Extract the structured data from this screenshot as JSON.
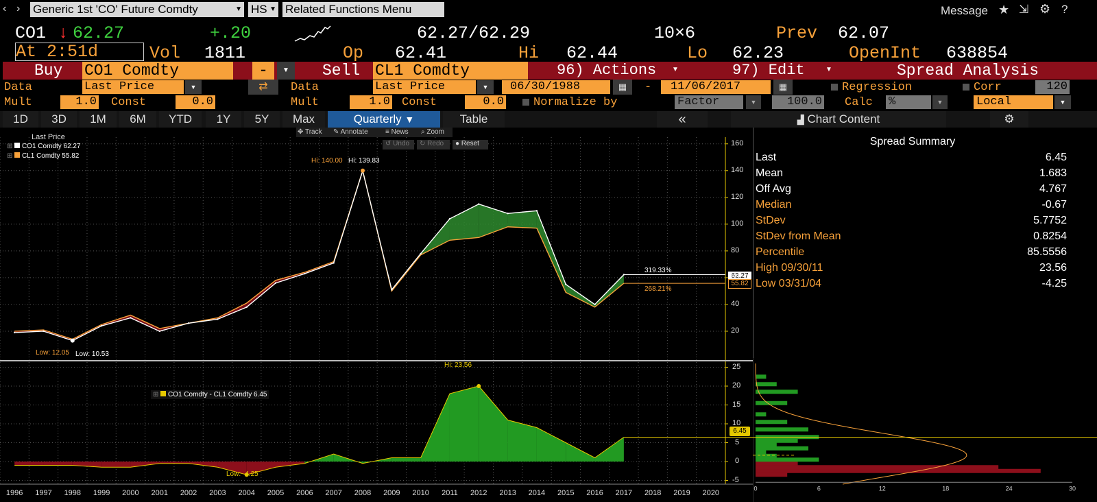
{
  "topbar": {
    "security_title": "Generic 1st 'CO' Future Comdty",
    "hs_label": "HS",
    "related_label": "Related Functions  Menu",
    "message_label": "Message",
    "icons": [
      "star-icon",
      "export-icon",
      "gear-icon",
      "help-icon"
    ]
  },
  "quote": {
    "ticker": "CO1",
    "arrow": "↓",
    "last": "62.27",
    "change": "+.20",
    "bid_ask": "62.27/62.29",
    "size": "10×6",
    "prev_label": "Prev",
    "prev": "62.07",
    "time_label": "At 2:51d",
    "vol_label": "Vol",
    "vol": "1811",
    "open_label": "Op",
    "open": "62.41",
    "hi_label": "Hi",
    "hi": "62.44",
    "lo_label": "Lo",
    "lo": "62.23",
    "oi_label": "OpenInt",
    "oi": "638854"
  },
  "spread_bar": {
    "buy_label": "Buy",
    "buy_ticker": "CO1 Comdty",
    "minus": "-",
    "sell_label": "Sell",
    "sell_ticker": "CL1 Comdty",
    "actions_label": "96) Actions",
    "edit_label": "97) Edit",
    "analysis_label": "Spread Analysis"
  },
  "params": {
    "data_label": "Data",
    "buy_field": "Last Price",
    "sell_field": "Last Price",
    "start_date": "06/30/1988",
    "dash": "-",
    "end_date": "11/06/2017",
    "regression_label": "Regression",
    "corr_label": "Corr",
    "corr_value": "120",
    "mult_label": "Mult",
    "const_label": "Const",
    "buy_mult": "1.0",
    "buy_const": "0.0",
    "sell_mult": "1.0",
    "sell_const": "0.0",
    "normalize_label": "Normalize by",
    "factor_label": "Factor",
    "factor_value": "100.0",
    "calc_label": "Calc",
    "calc_value": "%",
    "local_value": "Local"
  },
  "tabs": [
    "1D",
    "3D",
    "1M",
    "6M",
    "YTD",
    "1Y",
    "5Y",
    "Max"
  ],
  "period_selected": "Quarterly",
  "table_label": "Table",
  "collapse_label": "«",
  "chart_content_label": "Chart Content",
  "toolbar": {
    "track": "Track",
    "annotate": "Annotate",
    "news": "News",
    "zoom": "Zoom",
    "undo": "Undo",
    "redo": "Redo",
    "reset": "Reset"
  },
  "legend": {
    "title": "Last Price",
    "s1": "CO1 Comdty 62.27",
    "s2": "CL1 Comdty 55.82",
    "spread": "CO1 Comdty - CL1 Comdty 6.45"
  },
  "annotations": {
    "hi_orange": "Hi: 140.00",
    "hi_white": "Hi: 139.83",
    "low_orange": "Low: 12.05",
    "low_white": "Low: 10.53",
    "pct_white": "319.33%",
    "pct_orange": "268.21%",
    "last_white": "62.27",
    "last_orange": "55.82",
    "spread_hi": "Hi: 23.56",
    "spread_low": "Low: -4.25",
    "spread_last": "6.45"
  },
  "summary": {
    "title": "Spread Summary",
    "rows": [
      {
        "label": "Last",
        "value": "6.45"
      },
      {
        "label": "Mean",
        "value": "1.683"
      },
      {
        "label": "Off Avg",
        "value": "4.767"
      },
      {
        "label": "Median",
        "value": "-0.67"
      },
      {
        "label": "StDev",
        "value": "5.7752"
      },
      {
        "label": "StDev from Mean",
        "value": "0.8254"
      },
      {
        "label": "Percentile",
        "value": "85.5556"
      },
      {
        "label": "High 09/30/11",
        "value": "23.56"
      },
      {
        "label": "Low 03/31/04",
        "value": "-4.25"
      }
    ]
  },
  "colors": {
    "brent": "#ffffff",
    "wti": "#f7a13a",
    "pos_fill": "#2e8b2e",
    "neg_fill": "#8c0f1b",
    "accent": "#f7a13a"
  },
  "chart_data": [
    {
      "type": "line",
      "x": [
        "1996",
        "1997",
        "1998",
        "1999",
        "2000",
        "2001",
        "2002",
        "2003",
        "2004",
        "2005",
        "2006",
        "2007",
        "2008",
        "2009",
        "2010",
        "2011",
        "2012",
        "2013",
        "2014",
        "2015",
        "2016",
        "2017"
      ],
      "series": [
        {
          "name": "CO1 Comdty",
          "values": [
            19,
            20,
            13,
            24,
            30,
            20,
            26,
            29,
            38,
            56,
            63,
            71,
            139.83,
            51,
            78,
            104,
            115,
            108,
            110,
            55,
            40,
            62.27
          ]
        },
        {
          "name": "CL1 Comdty",
          "values": [
            20,
            21,
            14,
            25,
            32,
            22,
            26,
            30,
            41,
            58,
            64,
            72,
            140,
            50,
            77,
            88,
            90,
            98,
            97,
            49,
            38,
            55.82
          ]
        }
      ],
      "ylim": [
        0,
        165
      ],
      "yticks": [
        "160",
        "140",
        "120",
        "100",
        "80",
        "60",
        "40",
        "20"
      ]
    },
    {
      "type": "area",
      "x": [
        "1996",
        "1997",
        "1998",
        "1999",
        "2000",
        "2001",
        "2002",
        "2003",
        "2004",
        "2005",
        "2006",
        "2007",
        "2008",
        "2009",
        "2010",
        "2011",
        "2012",
        "2013",
        "2014",
        "2015",
        "2016",
        "2017"
      ],
      "series": [
        {
          "name": "CO1 Comdty - CL1 Comdty",
          "values": [
            -1,
            -1,
            -1,
            -1.5,
            -1.5,
            -0.5,
            -0.5,
            -1.5,
            -3.5,
            -1.5,
            -0.5,
            2,
            -0.5,
            1,
            1,
            18,
            20,
            11,
            9,
            5,
            1,
            6.45
          ]
        }
      ],
      "ylim": [
        -6,
        26
      ],
      "yticks": [
        "25",
        "20",
        "15",
        "10",
        "5",
        "0",
        "-5"
      ],
      "xlabels": [
        "1996",
        "1997",
        "1998",
        "1999",
        "2000",
        "2001",
        "2002",
        "2003",
        "2004",
        "2005",
        "2006",
        "2007",
        "2008",
        "2009",
        "2010",
        "2011",
        "2012",
        "2013",
        "2014",
        "2015",
        "2016",
        "2017",
        "2018",
        "2019",
        "2020"
      ]
    },
    {
      "type": "bar",
      "orientation": "horizontal",
      "xticks": [
        "0",
        "6",
        "12",
        "18",
        "24",
        "30"
      ],
      "bins": [
        -4,
        -3,
        -2,
        -1,
        0,
        1,
        2,
        3,
        4,
        5,
        6,
        8,
        10,
        12,
        15,
        18,
        20,
        22
      ],
      "counts": [
        3,
        27,
        23,
        4,
        6,
        2,
        1,
        5,
        2,
        4,
        6,
        5,
        3,
        1,
        3,
        4,
        2,
        1
      ]
    }
  ]
}
